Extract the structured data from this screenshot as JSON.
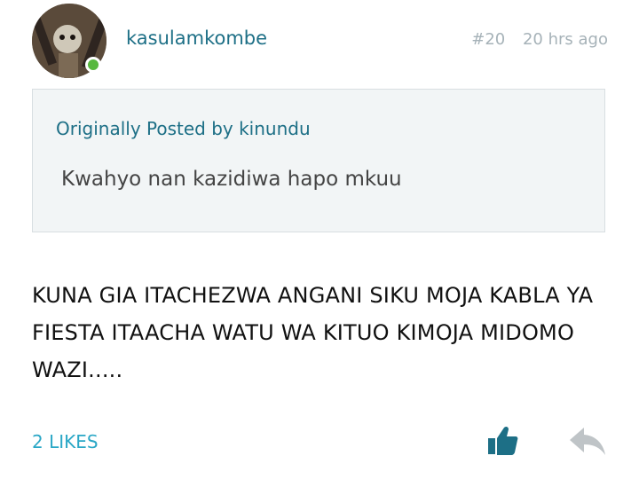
{
  "post": {
    "username": "kasulamkombe",
    "post_number": "#20",
    "time_ago": "20 hrs ago"
  },
  "quote": {
    "header": "Originally Posted by kinundu",
    "text": "Kwahyo nan kazidiwa hapo mkuu"
  },
  "body": {
    "text": "KUNA GIA ITACHEZWA ANGANI SIKU MOJA KABLA YA FIESTA ITAACHA WATU WA KITUO KIMOJA MIDOMO WAZI....."
  },
  "footer": {
    "likes": "2 LIKES"
  },
  "icons": {
    "like": "thumbs-up-icon",
    "reply": "reply-icon"
  },
  "colors": {
    "accent": "#1d6f86",
    "likes": "#2aa7c6",
    "online": "#58b83f",
    "muted": "#a6b2b8"
  }
}
